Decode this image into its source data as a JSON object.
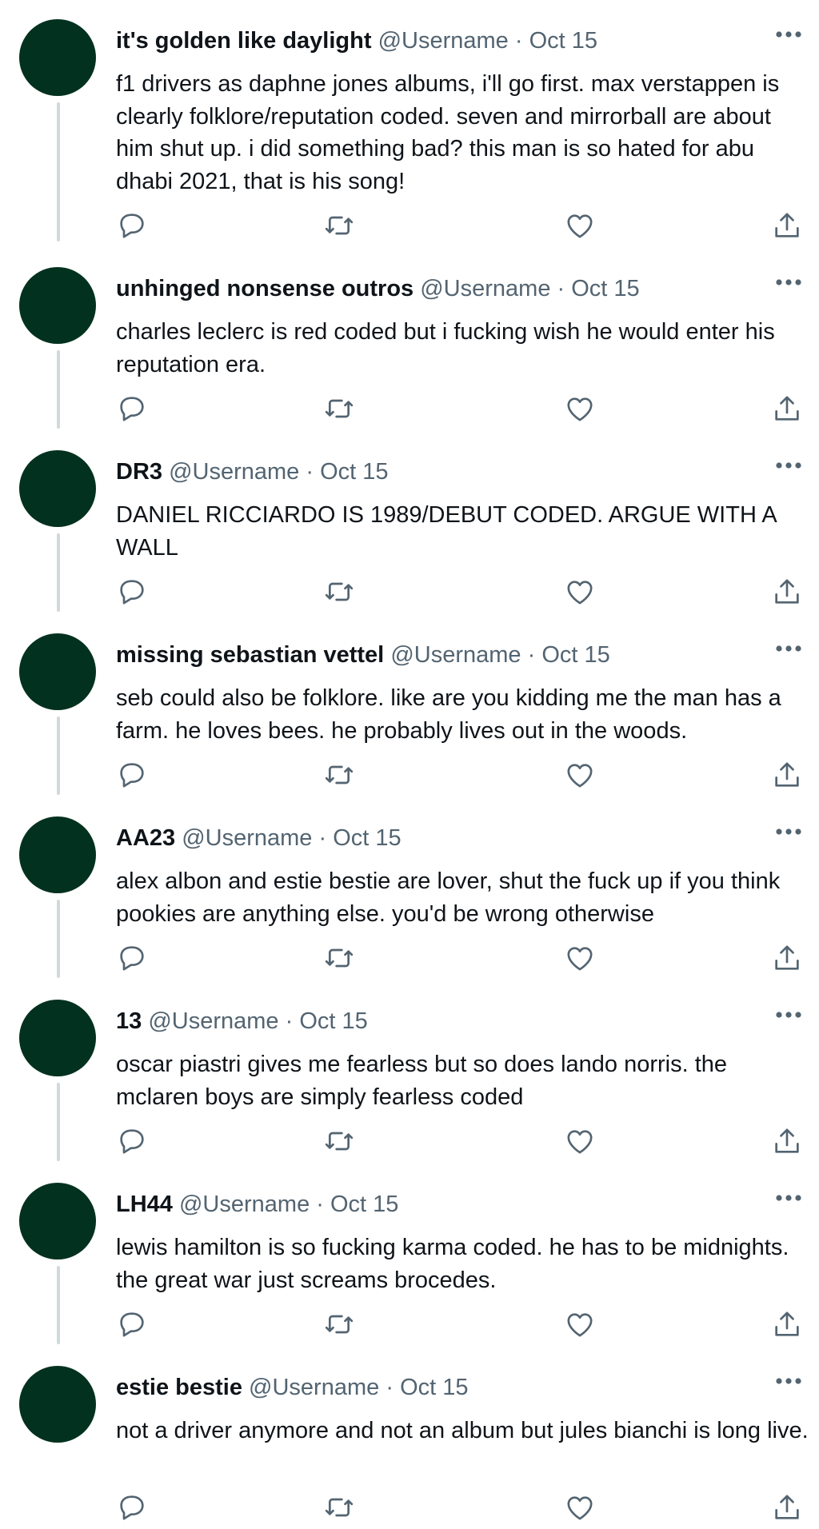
{
  "colors": {
    "avatar": "#03311f",
    "thread_line": "#cfd9de",
    "text_primary": "#0f1419",
    "text_secondary": "#536471",
    "icon": "#536471"
  },
  "icons": {
    "reply": "speech-bubble",
    "retweet": "two-arrows-loop",
    "like": "heart-outline",
    "share": "upload-arrow",
    "more": "three-dots"
  },
  "tweets": [
    {
      "name": "it's golden like daylight",
      "handle": "@Username",
      "separator": "·",
      "date": "Oct 15",
      "text": "f1 drivers as daphne jones albums, i'll go first. max verstappen is clearly folklore/reputation coded. seven and mirrorball are about him shut up. i did something bad? this man is so hated for abu dhabi 2021, that is his song!"
    },
    {
      "name": "unhinged nonsense outros",
      "handle": "@Username",
      "separator": "·",
      "date": "Oct 15",
      "text": "charles leclerc is red coded but i fucking wish he would enter his reputation era."
    },
    {
      "name": "DR3",
      "handle": "@Username",
      "separator": "·",
      "date": "Oct 15",
      "text": "DANIEL RICCIARDO IS 1989/DEBUT CODED. ARGUE WITH A WALL"
    },
    {
      "name": "missing sebastian vettel",
      "handle": "@Username",
      "separator": "·",
      "date": "Oct 15",
      "text": "seb could also be folklore. like are you kidding me the man has a farm. he loves bees. he probably lives out in the woods."
    },
    {
      "name": "AA23",
      "handle": "@Username",
      "separator": "·",
      "date": "Oct 15",
      "text": "alex albon and estie bestie are lover, shut the fuck up if you think pookies are anything else. you'd be wrong otherwise"
    },
    {
      "name": "13",
      "handle": "@Username",
      "separator": "·",
      "date": "Oct 15",
      "text": "oscar piastri gives me fearless but so does lando norris. the mclaren boys are simply fearless coded"
    },
    {
      "name": "LH44",
      "handle": "@Username",
      "separator": "·",
      "date": "Oct 15",
      "text": "lewis hamilton is so fucking karma coded. he has to be midnights. the great war just screams brocedes."
    },
    {
      "name": "estie bestie",
      "handle": "@Username",
      "separator": "·",
      "date": "Oct 15",
      "text": "not a driver anymore and not an album but jules bianchi is long live."
    }
  ]
}
